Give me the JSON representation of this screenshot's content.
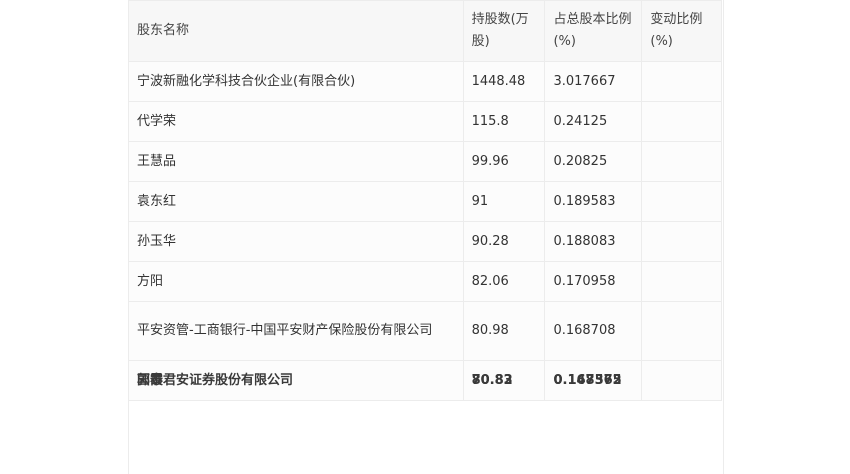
{
  "table": {
    "headers": [
      "股东名称",
      "持股数(万股)",
      "占总股本比例(%)",
      "变动比例(%)"
    ],
    "rows": [
      {
        "name": "宁波新融化学科技合伙企业(有限合伙)",
        "shares": "1448.48",
        "ratio": "3.017667",
        "change": ""
      },
      {
        "name": "代学荣",
        "shares": "115.8",
        "ratio": "0.24125",
        "change": ""
      },
      {
        "name": "王慧品",
        "shares": "99.96",
        "ratio": "0.20825",
        "change": ""
      },
      {
        "name": "袁东红",
        "shares": "91",
        "ratio": "0.189583",
        "change": ""
      },
      {
        "name": "孙玉华",
        "shares": "90.28",
        "ratio": "0.188083",
        "change": ""
      },
      {
        "name": "方阳",
        "shares": "82.06",
        "ratio": "0.170958",
        "change": ""
      },
      {
        "name": "平安资管-工商银行-中国平安财产保险股份有限公司",
        "shares": "80.98",
        "ratio": "0.168708",
        "change": ""
      }
    ],
    "overlapped_row": {
      "names": [
        "郭霞",
        "国泰君安证券股份有限公司"
      ],
      "shares": [
        "70.83",
        "80.82"
      ],
      "ratios": [
        "0.147562",
        "0.168375"
      ],
      "change": ""
    }
  }
}
